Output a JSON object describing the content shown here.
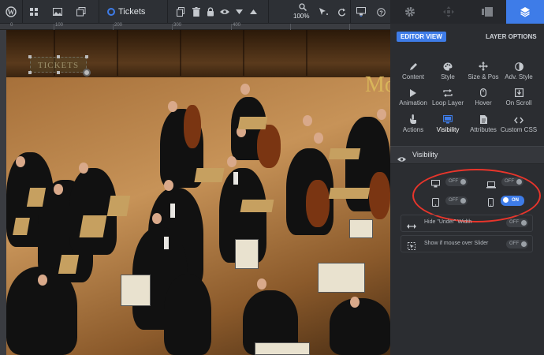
{
  "toolbar": {
    "layer_title": "Tickets",
    "zoom": "100%",
    "icons": [
      "wordpress-icon",
      "grid-icon",
      "image-icon",
      "layers-stack-icon",
      "copy-icon",
      "trash-icon",
      "lock-icon",
      "eye-icon",
      "arrow-down-icon",
      "arrow-up-icon",
      "zoom-icon",
      "cursor-icon",
      "undo-icon",
      "desktop-icon",
      "help-icon"
    ]
  },
  "panel_tabs": [
    "gear-icon",
    "move-icon",
    "gallery-icon",
    "layers-icon"
  ],
  "ruler": {
    "labels": [
      "0",
      "100",
      "200",
      "300",
      "400"
    ]
  },
  "canvas": {
    "text_layer": "TICKETS",
    "heading_fragment": "Mo"
  },
  "panel": {
    "editor_view": "EDITOR VIEW",
    "layer_options": "LAYER OPTIONS",
    "options": [
      {
        "label": "Content",
        "icon": "pen-icon"
      },
      {
        "label": "Style",
        "icon": "palette-icon"
      },
      {
        "label": "Size & Pos",
        "icon": "move-arrows-icon"
      },
      {
        "label": "Adv. Style",
        "icon": "contrast-icon"
      },
      {
        "label": "Animation",
        "icon": "play-icon"
      },
      {
        "label": "Loop Layer",
        "icon": "loop-icon"
      },
      {
        "label": "Hover",
        "icon": "mouse-icon"
      },
      {
        "label": "On Scroll",
        "icon": "scroll-icon"
      },
      {
        "label": "Actions",
        "icon": "hand-icon"
      },
      {
        "label": "Visibility",
        "icon": "monitor-icon"
      },
      {
        "label": "Attributes",
        "icon": "document-icon"
      },
      {
        "label": "Custom CSS",
        "icon": "code-icon"
      }
    ],
    "visibility": {
      "title": "Visibility",
      "devices": [
        {
          "device": "desktop",
          "state": "OFF"
        },
        {
          "device": "laptop",
          "state": "OFF"
        },
        {
          "device": "tablet",
          "state": "OFF"
        },
        {
          "device": "mobile",
          "state": "ON"
        }
      ],
      "hide_under": {
        "label": "Hide \"Under\" Width",
        "state": "OFF"
      },
      "show_if_mouse": {
        "label": "Show if mouse over Slider",
        "state": "OFF"
      }
    }
  },
  "colors": {
    "accent": "#3e7ce8",
    "highlight": "#e8352b"
  }
}
